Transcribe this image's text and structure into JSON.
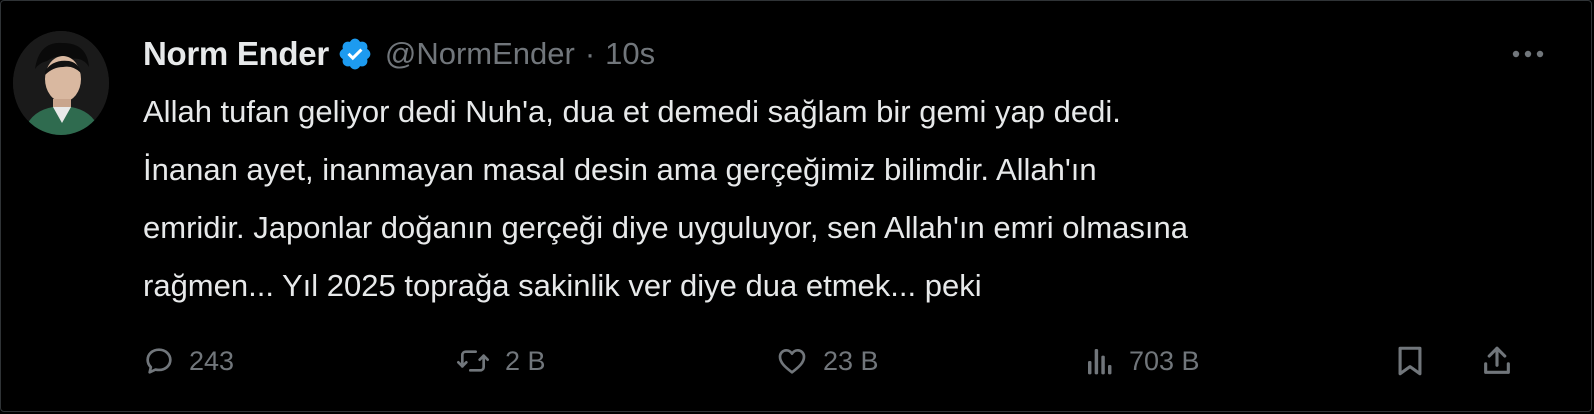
{
  "author": {
    "display_name": "Norm Ender",
    "handle": "@NormEnder",
    "separator": "·",
    "timestamp": "10s",
    "verified": true
  },
  "tweet": {
    "lines": [
      "Allah tufan geliyor dedi Nuh'a, dua et demedi sağlam bir gemi yap dedi.",
      "İnanan ayet, inanmayan masal desin ama gerçeğimiz bilimdir. Allah'ın",
      "emridir. Japonlar doğanın gerçeği diye uyguluyor, sen Allah'ın emri olmasına",
      "rağmen... Yıl 2025 toprağa sakinlik ver diye dua etmek... peki"
    ]
  },
  "actions": {
    "replies": "243",
    "reposts": "2 B",
    "likes": "23 B",
    "views": "703 B"
  },
  "icons": {
    "more": "more-dots-icon",
    "verified": "verified-badge-icon",
    "reply": "reply-icon",
    "repost": "repost-icon",
    "like": "heart-icon",
    "views": "views-chart-icon",
    "bookmark": "bookmark-icon",
    "share": "share-icon"
  },
  "colors": {
    "background": "#000000",
    "text": "#e7e9ea",
    "muted": "#71767b",
    "verified": "#1d9bf0"
  }
}
